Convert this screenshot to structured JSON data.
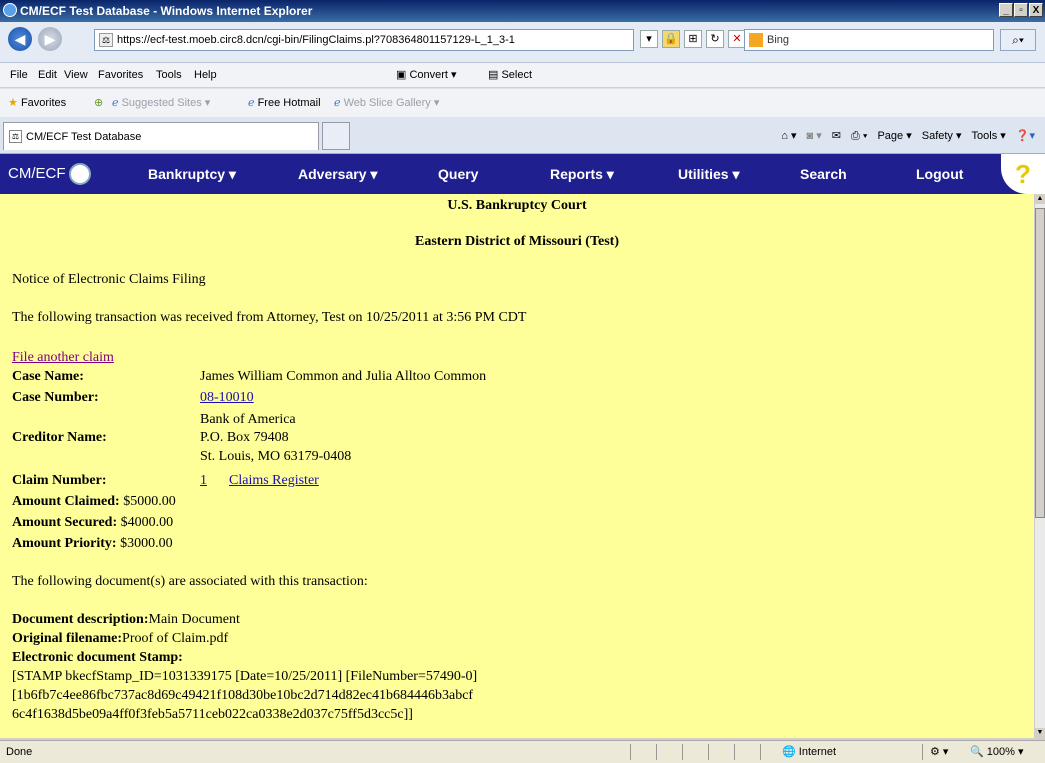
{
  "window": {
    "title": "CM/ECF Test Database - Windows Internet Explorer",
    "controls": [
      "_",
      "▫",
      "X"
    ]
  },
  "address": {
    "url": "https://ecf-test.moeb.circ8.dcn/cgi-bin/FilingClaims.pl?708364801157129-L_1_3-1",
    "search_placeholder": "Bing"
  },
  "menu": {
    "items": [
      "File",
      "Edit",
      "View",
      "Favorites",
      "Tools",
      "Help"
    ],
    "convert": "Convert",
    "select": "Select"
  },
  "favorites": {
    "label": "Favorites",
    "items": [
      "Suggested Sites ▾",
      "Free Hotmail",
      "Web Slice Gallery ▾"
    ]
  },
  "tab": {
    "label": "CM/ECF Test Database",
    "commands": [
      "Page ▾",
      "Safety ▾",
      "Tools ▾"
    ]
  },
  "appnav": {
    "logo": "CM/ECF",
    "items": [
      "Bankruptcy ▾",
      "Adversary ▾",
      "Query",
      "Reports ▾",
      "Utilities ▾",
      "Search",
      "Logout"
    ]
  },
  "page": {
    "court": "U.S. Bankruptcy Court",
    "district": "Eastern District of Missouri (Test)",
    "notice": "Notice of Electronic Claims Filing",
    "transaction": "The following transaction was received from Attorney, Test on 10/25/2011 at 3:56 PM CDT",
    "file_another": "File another claim",
    "case_name_label": "Case Name:",
    "case_name": "James William Common and Julia Alltoo Common",
    "case_number_label": "Case Number:",
    "case_number": "08-10010",
    "creditor_label": "Creditor Name:",
    "creditor_lines": [
      "Bank of America",
      "P.O. Box 79408",
      "St. Louis, MO 63179-0408"
    ],
    "claim_number_label": "Claim Number:",
    "claim_number": "1",
    "claims_register": "Claims Register",
    "amount_claimed_label": "Amount Claimed:",
    "amount_claimed": "$5000.00",
    "amount_secured_label": "Amount Secured:",
    "amount_secured": "$4000.00",
    "amount_priority_label": "Amount Priority:",
    "amount_priority": "$3000.00",
    "docs_intro": "The following document(s) are associated with this transaction:",
    "doc_desc_label": "Document description:",
    "doc_desc": "Main Document",
    "orig_filename_label": "Original filename:",
    "orig_filename": "Proof of Claim.pdf",
    "stamp_label": "Electronic document Stamp:",
    "stamp_lines": [
      "[STAMP bkecfStamp_ID=1031339175 [Date=10/25/2011] [FileNumber=57490-0]",
      "[1b6fb7c4ee86fbc737ac8d69c49421f108d30be10bc2d714d82ec41b684446b3abcf",
      "6c4f1638d5be09a4ff0f3feb5a5711ceb022ca0338e2d037c75ff5d3cc5c]]"
    ]
  },
  "status": {
    "left": "Done",
    "zone": "Internet",
    "zoom": "100%"
  }
}
